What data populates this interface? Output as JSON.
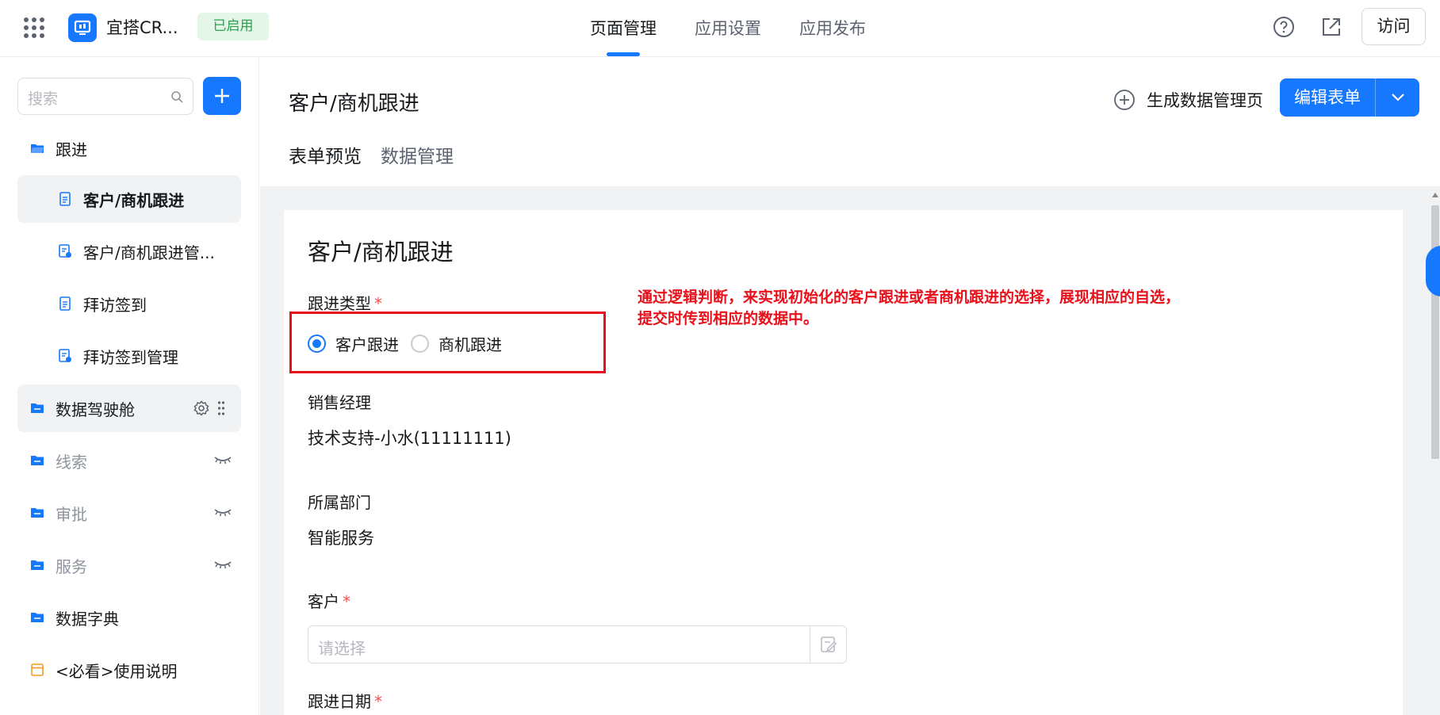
{
  "app": {
    "name": "宜搭CR...",
    "status": "已启用"
  },
  "top_nav": [
    {
      "label": "页面管理",
      "active": true
    },
    {
      "label": "应用设置",
      "active": false
    },
    {
      "label": "应用发布",
      "active": false
    }
  ],
  "top_actions": {
    "help_icon": "help-icon",
    "open_icon": "external-link-icon",
    "visit_label": "访问"
  },
  "sidebar": {
    "search_placeholder": "搜索",
    "add_icon": "plus-icon",
    "items": [
      {
        "label": "跟进",
        "icon": "folder-open-icon"
      },
      {
        "label": "客户/商机跟进",
        "icon": "form-doc-icon",
        "selected": true
      },
      {
        "label": "客户/商机跟进管...",
        "icon": "report-icon"
      },
      {
        "label": "拜访签到",
        "icon": "form-doc-icon"
      },
      {
        "label": "拜访签到管理",
        "icon": "report-icon"
      },
      {
        "label": "数据驾驶舱",
        "icon": "folder-icon"
      },
      {
        "label": "线索",
        "icon": "folder-icon",
        "hidden": true
      },
      {
        "label": "审批",
        "icon": "folder-icon",
        "hidden": true
      },
      {
        "label": "服务",
        "icon": "folder-icon",
        "hidden": true
      },
      {
        "label": "数据字典",
        "icon": "folder-icon"
      },
      {
        "label": "<必看>使用说明",
        "icon": "page-icon"
      }
    ]
  },
  "header": {
    "title": "客户/商机跟进",
    "generate_label": "生成数据管理页",
    "edit_label": "编辑表单",
    "tabs": [
      {
        "label": "表单预览",
        "active": true
      },
      {
        "label": "数据管理",
        "active": false
      }
    ]
  },
  "form": {
    "title": "客户/商机跟进",
    "follow_type": {
      "label": "跟进类型",
      "required_mark": "*",
      "options": [
        {
          "label": "客户跟进",
          "checked": true
        },
        {
          "label": "商机跟进",
          "checked": false
        }
      ]
    },
    "sales_manager": {
      "label": "销售经理",
      "value": "技术支持-小水(11111111)"
    },
    "department": {
      "label": "所属部门",
      "value": "智能服务"
    },
    "customer": {
      "label": "客户",
      "required_mark": "*",
      "placeholder": "请选择"
    },
    "follow_date": {
      "label": "跟进日期",
      "required_mark": "*"
    }
  },
  "annotation": {
    "line1": "通过逻辑判断，来实现初始化的客户跟进或者商机跟进的选择，展现相应的自选，",
    "line2": "提交时传到相应的数据中。",
    "color": "#e8101a"
  },
  "colors": {
    "accent": "#1677ff",
    "status_green": "#2ea050",
    "required": "#ff4d4f"
  }
}
